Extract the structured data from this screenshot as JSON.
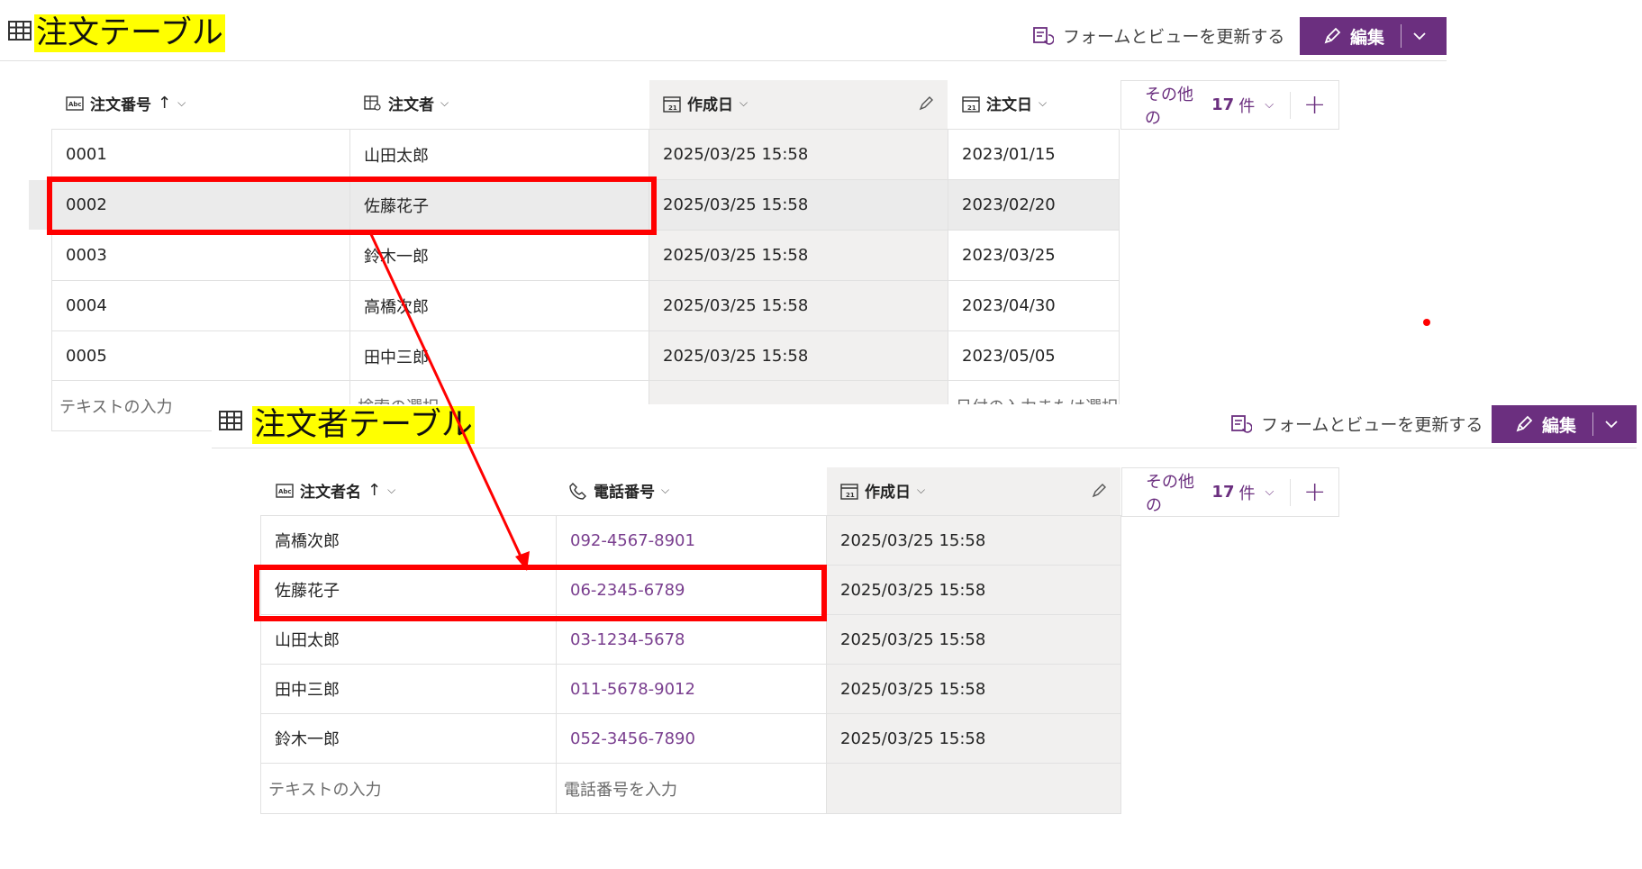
{
  "colors": {
    "accent": "#6b2f7f",
    "highlight": "#ffff00",
    "annotation": "#ff0000"
  },
  "order_table": {
    "title": "注文テーブル",
    "refresh_label": "フォームとビューを更新する",
    "edit_label": "編集",
    "more_columns": {
      "prefix": "その他の",
      "count": "17",
      "suffix": "件"
    },
    "columns": [
      {
        "label": "注文番号",
        "sort": "↑",
        "icon": "text-column-icon"
      },
      {
        "label": "注文者",
        "icon": "lookup-column-icon"
      },
      {
        "label": "作成日",
        "icon": "calendar-icon"
      },
      {
        "label": "注文日",
        "icon": "calendar-icon"
      }
    ],
    "rows": [
      [
        "0001",
        "山田太郎",
        "2025/03/25 15:58",
        "2023/01/15"
      ],
      [
        "0002",
        "佐藤花子",
        "2025/03/25 15:58",
        "2023/02/20"
      ],
      [
        "0003",
        "鈴木一郎",
        "2025/03/25 15:58",
        "2023/03/25"
      ],
      [
        "0004",
        "高橋次郎",
        "2025/03/25 15:58",
        "2023/04/30"
      ],
      [
        "0005",
        "田中三郎",
        "2025/03/25 15:58",
        "2023/05/05"
      ]
    ],
    "new_row": {
      "col1": "テキストの入力",
      "col2": "検索の選択",
      "col4": "日付の入力または選択"
    }
  },
  "customer_table": {
    "title": "注文者テーブル",
    "refresh_label": "フォームとビューを更新する",
    "edit_label": "編集",
    "more_columns": {
      "prefix": "その他の",
      "count": "17",
      "suffix": "件"
    },
    "columns": [
      {
        "label": "注文者名",
        "sort": "↑",
        "icon": "text-column-icon"
      },
      {
        "label": "電話番号",
        "icon": "phone-icon"
      },
      {
        "label": "作成日",
        "icon": "calendar-icon"
      }
    ],
    "rows": [
      [
        "高橋次郎",
        "092-4567-8901",
        "2025/03/25 15:58"
      ],
      [
        "佐藤花子",
        "06-2345-6789",
        "2025/03/25 15:58"
      ],
      [
        "山田太郎",
        "03-1234-5678",
        "2025/03/25 15:58"
      ],
      [
        "田中三郎",
        "011-5678-9012",
        "2025/03/25 15:58"
      ],
      [
        "鈴木一郎",
        "052-3456-7890",
        "2025/03/25 15:58"
      ]
    ],
    "new_row": {
      "col1": "テキストの入力",
      "col2": "電話番号を入力"
    }
  }
}
